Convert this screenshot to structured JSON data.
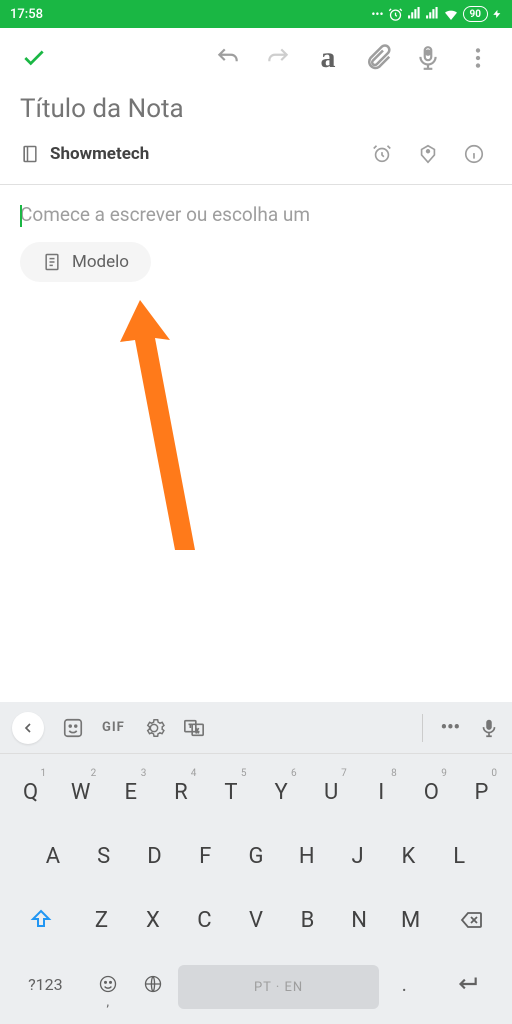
{
  "status": {
    "time": "17:58",
    "battery": "90"
  },
  "toolbar": {
    "format_letter": "a"
  },
  "note": {
    "title_placeholder": "Título da Nota",
    "notebook": "Showmetech",
    "body_placeholder": "Comece a escrever ou escolha um",
    "template_label": "Modelo"
  },
  "keyboard": {
    "gif": "GIF",
    "sym": "?123",
    "comma": ",",
    "period": ".",
    "space_label": "PT · EN",
    "row1": [
      {
        "k": "Q",
        "s": "1"
      },
      {
        "k": "W",
        "s": "2"
      },
      {
        "k": "E",
        "s": "3"
      },
      {
        "k": "R",
        "s": "4"
      },
      {
        "k": "T",
        "s": "5"
      },
      {
        "k": "Y",
        "s": "6"
      },
      {
        "k": "U",
        "s": "7"
      },
      {
        "k": "I",
        "s": "8"
      },
      {
        "k": "O",
        "s": "9"
      },
      {
        "k": "P",
        "s": "0"
      }
    ],
    "row2": [
      "A",
      "S",
      "D",
      "F",
      "G",
      "H",
      "J",
      "K",
      "L"
    ],
    "row3": [
      "Z",
      "X",
      "C",
      "V",
      "B",
      "N",
      "M"
    ]
  }
}
